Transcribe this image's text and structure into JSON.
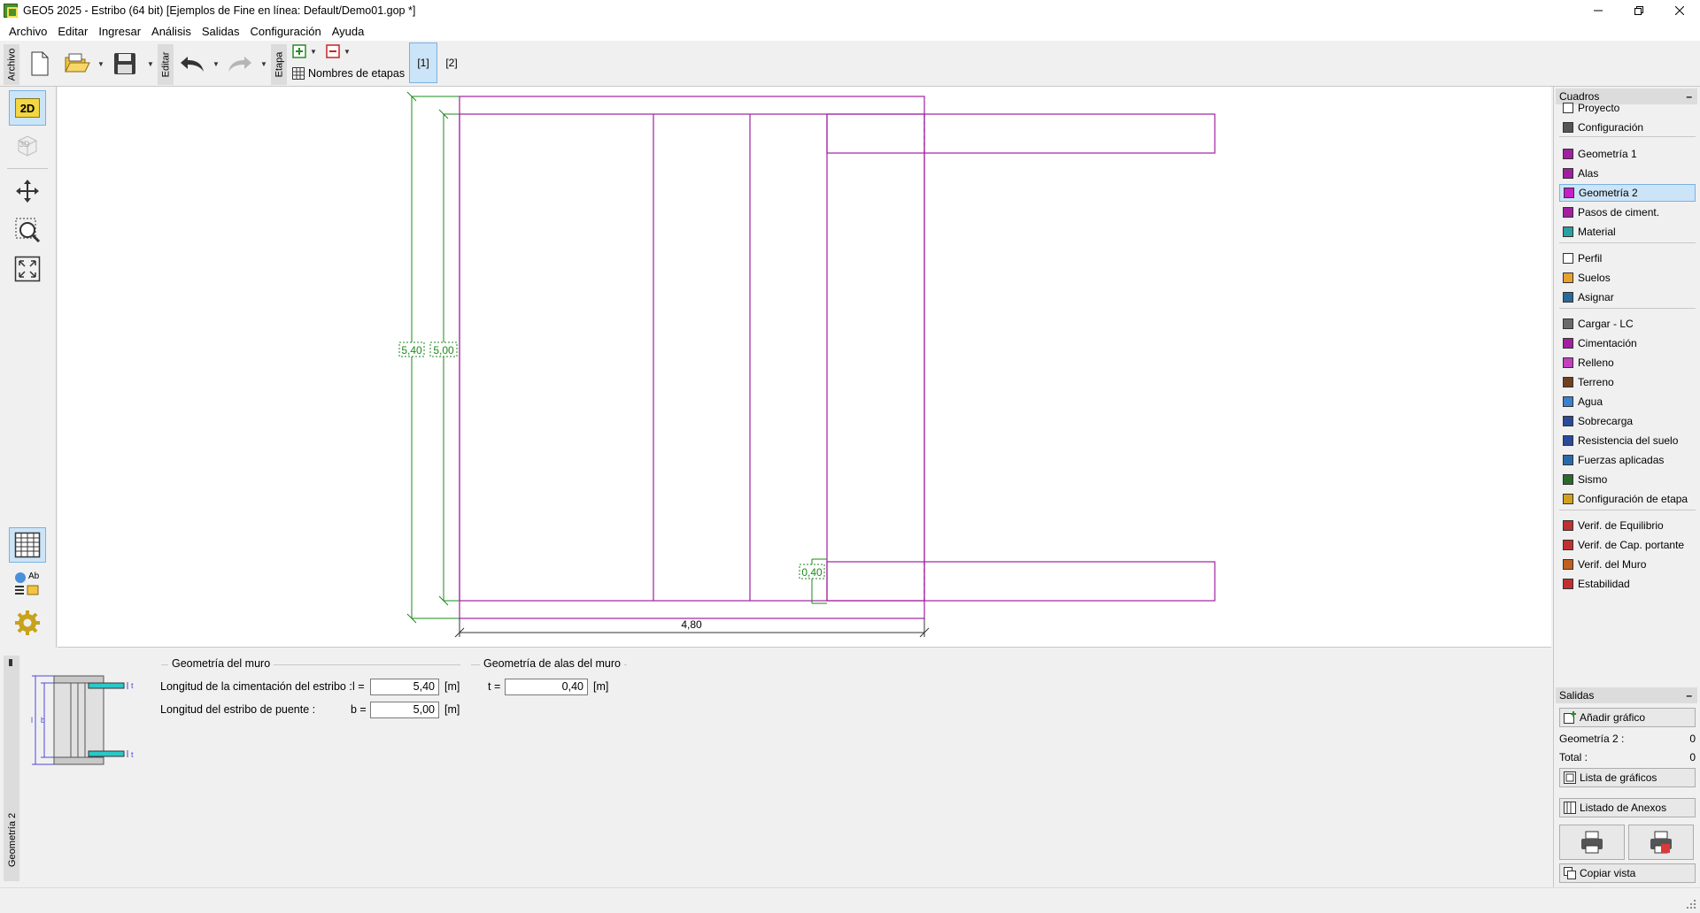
{
  "window": {
    "title": "GEO5 2025 - Estribo (64 bit) [Ejemplos de Fine en línea: Default/Demo01.gop *]"
  },
  "menu": {
    "items": [
      "Archivo",
      "Editar",
      "Ingresar",
      "Análisis",
      "Salidas",
      "Configuración",
      "Ayuda"
    ]
  },
  "toolbar": {
    "archivo_label": "Archivo",
    "editar_label": "Editar",
    "etapa_label": "Etapa",
    "stage_names_label": "Nombres de etapas",
    "stage_1": "[1]",
    "stage_2": "[2]"
  },
  "left_tools": {
    "view_2d": "2D",
    "view_3d": "3D",
    "ab_label": "Ab"
  },
  "drawing": {
    "dim_length": "5,40",
    "dim_bridge": "5,00",
    "dim_width": "4,80",
    "dim_wing": "0,40",
    "colors": {
      "wall": "#a020a0",
      "dimension": "#1a8a1a",
      "dim_text": "#1a8a1a"
    }
  },
  "bottom": {
    "side_label": "Geometría 2",
    "group_wall": "Geometría del muro",
    "group_wings": "Geometría de alas del muro",
    "length_found_label": "Longitud de la cimentación del estribo :",
    "length_found_symbol": "l =",
    "length_found_value": "5,40",
    "length_found_unit": "[m]",
    "bridge_length_label": "Longitud del estribo de puente :",
    "bridge_length_symbol": "b =",
    "bridge_length_value": "5,00",
    "bridge_length_unit": "[m]",
    "wing_symbol": "t =",
    "wing_value": "0,40",
    "wing_unit": "[m]",
    "diagram_l": "l",
    "diagram_b": "b",
    "diagram_t1": "t",
    "diagram_t2": "t"
  },
  "frames": {
    "header": "Cuadros",
    "items": [
      {
        "label": "Proyecto",
        "icon": "document-icon"
      },
      {
        "label": "Configuración",
        "icon": "gear-icon"
      },
      {
        "label": "Geometría 1",
        "icon": "wall-geometry-icon"
      },
      {
        "label": "Alas",
        "icon": "wings-icon"
      },
      {
        "label": "Geometría 2",
        "icon": "geometry-2-icon"
      },
      {
        "label": "Pasos de ciment.",
        "icon": "foundation-steps-icon"
      },
      {
        "label": "Material",
        "icon": "material-icon"
      },
      {
        "label": "Perfil",
        "icon": "profile-icon"
      },
      {
        "label": "Suelos",
        "icon": "soils-icon"
      },
      {
        "label": "Asignar",
        "icon": "assign-icon"
      },
      {
        "label": "Cargar - LC",
        "icon": "load-icon"
      },
      {
        "label": "Cimentación",
        "icon": "foundation-icon"
      },
      {
        "label": "Relleno",
        "icon": "backfill-icon"
      },
      {
        "label": "Terreno",
        "icon": "terrain-icon"
      },
      {
        "label": "Agua",
        "icon": "water-icon"
      },
      {
        "label": "Sobrecarga",
        "icon": "surcharge-icon"
      },
      {
        "label": "Resistencia del suelo",
        "icon": "front-face-resistance-icon"
      },
      {
        "label": "Fuerzas aplicadas",
        "icon": "applied-forces-icon"
      },
      {
        "label": "Sismo",
        "icon": "earthquake-icon"
      },
      {
        "label": "Configuración de etapa",
        "icon": "stage-settings-icon"
      },
      {
        "label": "Verif. de Equilibrio",
        "icon": "verification-icon"
      },
      {
        "label": "Verif. de Cap. portante",
        "icon": "bearing-capacity-icon"
      },
      {
        "label": "Verif. del Muro",
        "icon": "wall-check-icon"
      },
      {
        "label": "Estabilidad",
        "icon": "stability-icon"
      }
    ],
    "active_index": 4
  },
  "outputs": {
    "header": "Salidas",
    "add_picture": "Añadir gráfico",
    "geometry2_label": "Geometría 2 :",
    "geometry2_count": "0",
    "total_label": "Total :",
    "total_count": "0",
    "list_pictures": "Lista de gráficos",
    "list_attachments": "Listado de Anexos",
    "copy_view": "Copiar vista"
  }
}
